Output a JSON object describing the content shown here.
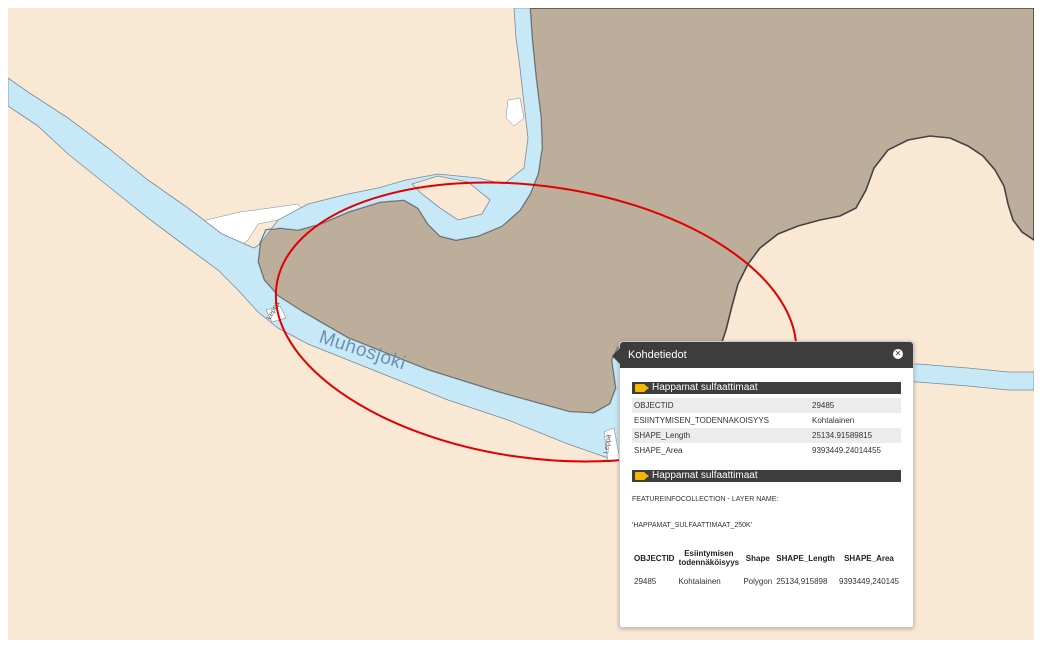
{
  "map": {
    "colors": {
      "land": "#f9e8d4",
      "soil_polygon": "#bdad9b",
      "polygon_outline": "#444444",
      "river": "#c7e8f6",
      "river_outline": "#7b8a96",
      "white_area": "#ffffff",
      "highlight_ellipse": "#e00000"
    },
    "river_label": "Muhosjoki",
    "road_label_1": "Leppä",
    "road_label_2": "Leppä"
  },
  "popup": {
    "title": "Kohdetiedot",
    "close_icon": "close-icon",
    "layer_name": "Happamat sulfaattimaat",
    "attributes": [
      {
        "key": "OBJECTID",
        "value": "29485"
      },
      {
        "key": "ESIINTYMISEN_TODENNAKOISYYS",
        "value": "Kohtalainen"
      },
      {
        "key": "SHAPE_Length",
        "value": "25134.91589815"
      },
      {
        "key": "SHAPE_Area",
        "value": "9393449.24014455"
      }
    ],
    "layer_name_2": "Happamat sulfaattimaat",
    "fic_line_1": "FEATUREINFOCOLLECTION - LAYER NAME:",
    "fic_line_2": "'HAPPAMAT_SULFAATTIMAAT_250K'",
    "fic_table": {
      "headers": [
        "OBJECTID",
        "Esiintymisen todennäköisyys",
        "Shape",
        "SHAPE_Length",
        "SHAPE_Area"
      ],
      "row": [
        "29485",
        "Kohtalainen",
        "Polygon",
        "25134,915898",
        "9393449,240145"
      ]
    }
  }
}
